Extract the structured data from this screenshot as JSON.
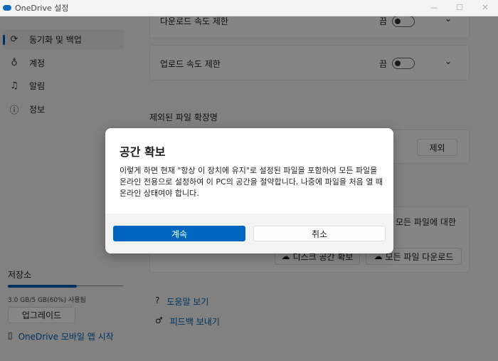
{
  "window": {
    "title": "OneDrive 설정",
    "minimize": "—",
    "maximize": "☐",
    "close": "✕"
  },
  "sidebar": {
    "items": [
      {
        "label": "동기화 및 백업",
        "icon": "sync-icon"
      },
      {
        "label": "계정",
        "icon": "person-icon"
      },
      {
        "label": "알림",
        "icon": "bell-icon"
      },
      {
        "label": "정보",
        "icon": "info-icon"
      }
    ],
    "storage": {
      "label": "저장소",
      "usage": "3.0 GB/5 GB(60%) 사용됨",
      "percent": 60,
      "upgrade": "업그레이드",
      "mobile": "OneDrive 모바일 앱 시작"
    }
  },
  "main": {
    "download_limit": {
      "label": "다운로드 속도 제한",
      "state": "끔"
    },
    "upload_limit": {
      "label": "업로드 속도 제한",
      "state": "끔"
    },
    "excluded_heading": "제외된 파일 확장명",
    "exclude_button": "제외",
    "partial_text": "모든 파일에 대한",
    "free_space_button": "디스크 공간 확보",
    "download_all_button": "모든 파일 다운로드",
    "help_link": "도움말 보기",
    "feedback_link": "피드백 보내기"
  },
  "dialog": {
    "title": "공간 확보",
    "body": "이렇게 하면 현재 \"항상 이 장치에 유지\"로 설정된 파일을 포함하여 모든 파일을 온라인 전용으로 설정하여 이 PC의 공간을 절약합니다. 나중에 파일을 처음 열 때 온라인 상태여야 합니다.",
    "continue": "계속",
    "cancel": "취소"
  },
  "colors": {
    "accent": "#0067c0"
  }
}
